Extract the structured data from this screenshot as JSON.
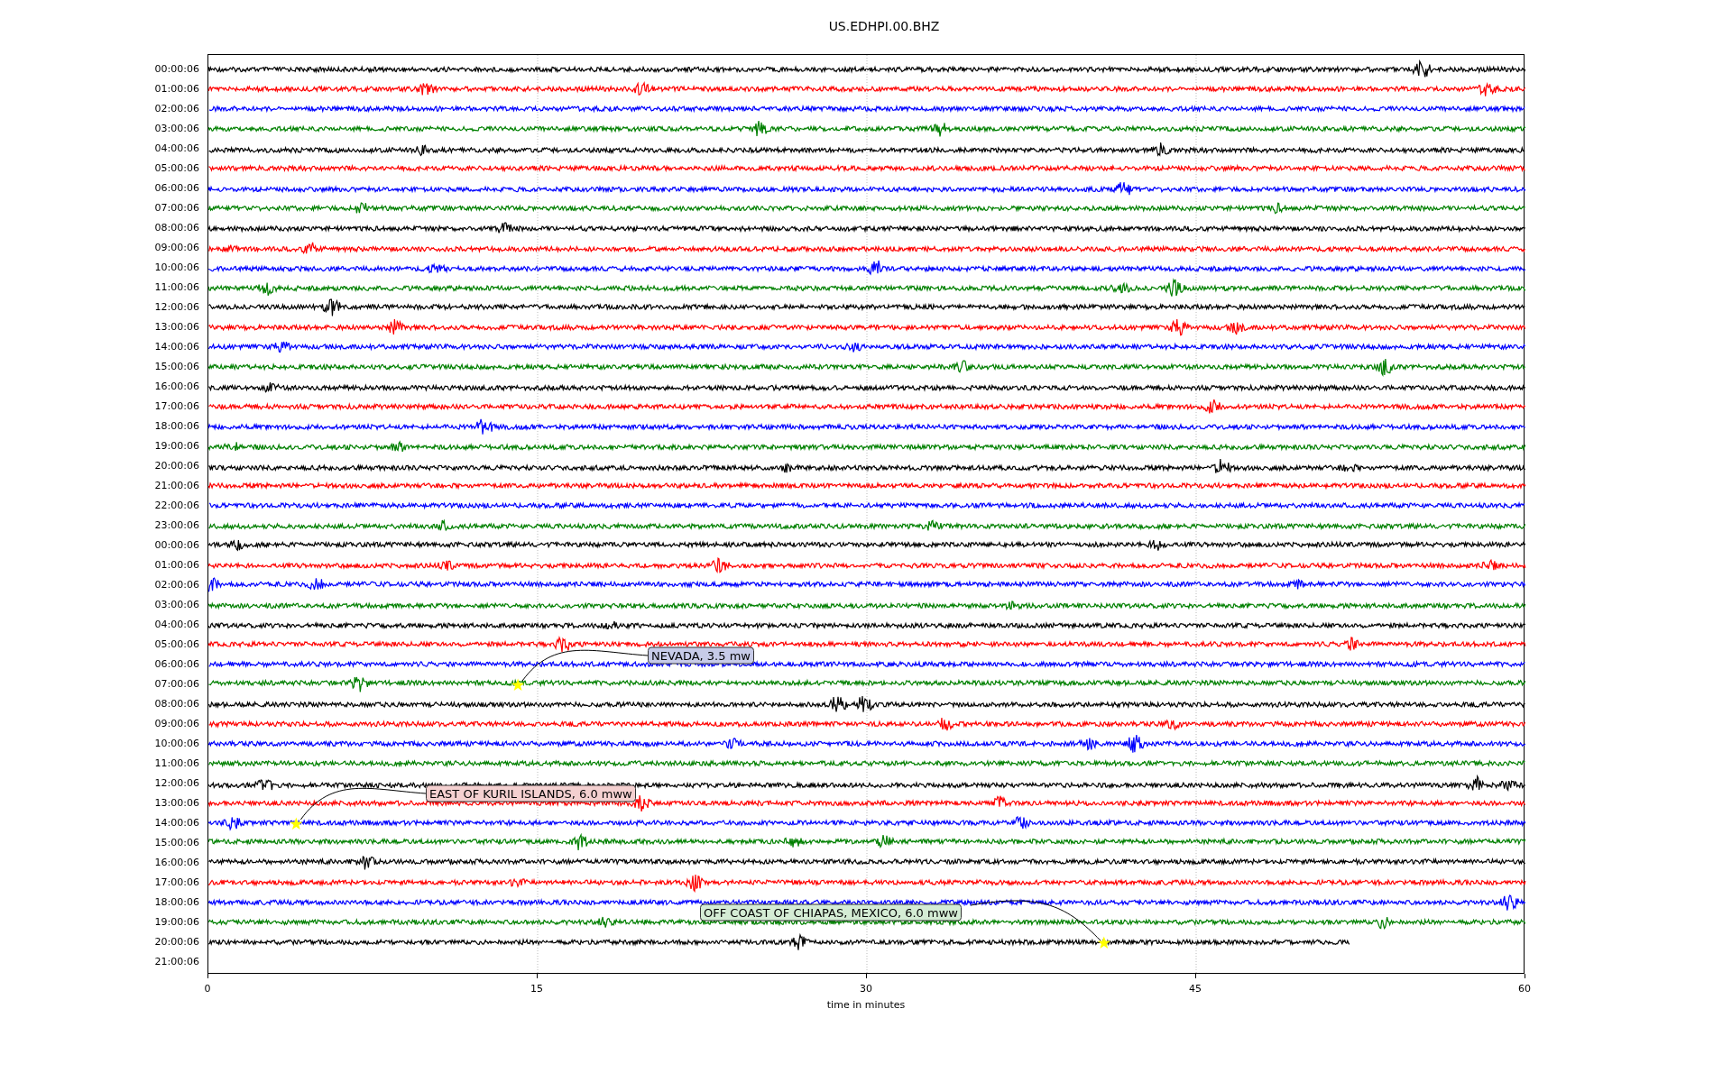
{
  "title": "US.EDHPI.00.BHZ",
  "xlabel": "time in minutes",
  "xticks": [
    "0",
    "15",
    "30",
    "45",
    "60"
  ],
  "rows": [
    {
      "label": "00:00:06",
      "kind": "full",
      "color": "#000000"
    },
    {
      "label": "01:00:06",
      "kind": "full",
      "color": "#ff0000"
    },
    {
      "label": "02:00:06",
      "kind": "full",
      "color": "#0000ff"
    },
    {
      "label": "03:00:06",
      "kind": "full",
      "color": "#008000"
    },
    {
      "label": "04:00:06",
      "kind": "full",
      "color": "#000000"
    },
    {
      "label": "05:00:06",
      "kind": "full",
      "color": "#ff0000"
    },
    {
      "label": "06:00:06",
      "kind": "full",
      "color": "#0000ff"
    },
    {
      "label": "07:00:06",
      "kind": "full",
      "color": "#008000"
    },
    {
      "label": "08:00:06",
      "kind": "full",
      "color": "#000000"
    },
    {
      "label": "09:00:06",
      "kind": "full",
      "color": "#ff0000"
    },
    {
      "label": "10:00:06",
      "kind": "full",
      "color": "#0000ff"
    },
    {
      "label": "11:00:06",
      "kind": "full",
      "color": "#008000"
    },
    {
      "label": "12:00:06",
      "kind": "full",
      "color": "#000000"
    },
    {
      "label": "13:00:06",
      "kind": "full",
      "color": "#ff0000"
    },
    {
      "label": "14:00:06",
      "kind": "full",
      "color": "#0000ff"
    },
    {
      "label": "15:00:06",
      "kind": "full",
      "color": "#008000"
    },
    {
      "label": "16:00:06",
      "kind": "full",
      "color": "#000000"
    },
    {
      "label": "17:00:06",
      "kind": "full",
      "color": "#ff0000"
    },
    {
      "label": "18:00:06",
      "kind": "full",
      "color": "#0000ff"
    },
    {
      "label": "19:00:06",
      "kind": "full",
      "color": "#008000"
    },
    {
      "label": "20:00:06",
      "kind": "full",
      "color": "#000000"
    },
    {
      "label": "21:00:06",
      "kind": "full",
      "color": "#ff0000"
    },
    {
      "label": "22:00:06",
      "kind": "full",
      "color": "#0000ff"
    },
    {
      "label": "23:00:06",
      "kind": "full",
      "color": "#008000"
    },
    {
      "label": "00:00:06",
      "kind": "full",
      "color": "#000000"
    },
    {
      "label": "01:00:06",
      "kind": "full",
      "color": "#ff0000"
    },
    {
      "label": "02:00:06",
      "kind": "full",
      "color": "#0000ff"
    },
    {
      "label": "03:00:06",
      "kind": "full",
      "color": "#008000"
    },
    {
      "label": "04:00:06",
      "kind": "full",
      "color": "#000000"
    },
    {
      "label": "05:00:06",
      "kind": "full",
      "color": "#ff0000"
    },
    {
      "label": "06:00:06",
      "kind": "full",
      "color": "#0000ff"
    },
    {
      "label": "07:00:06",
      "kind": "full",
      "color": "#008000",
      "event": {
        "label": "NEVADA, 3.5 mw"
      }
    },
    {
      "label": "08:00:06",
      "kind": "full",
      "color": "#000000"
    },
    {
      "label": "09:00:06",
      "kind": "full",
      "color": "#ff0000"
    },
    {
      "label": "10:00:06",
      "kind": "full",
      "color": "#0000ff"
    },
    {
      "label": "11:00:06",
      "kind": "full",
      "color": "#008000"
    },
    {
      "label": "12:00:06",
      "kind": "full",
      "color": "#000000"
    },
    {
      "label": "13:00:06",
      "kind": "full",
      "color": "#ff0000"
    },
    {
      "label": "14:00:06",
      "kind": "full",
      "color": "#0000ff",
      "event": {
        "label": "EAST OF KURIL ISLANDS, 6.0 mww"
      }
    },
    {
      "label": "15:00:06",
      "kind": "full",
      "color": "#008000"
    },
    {
      "label": "16:00:06",
      "kind": "full",
      "color": "#000000"
    },
    {
      "label": "17:00:06",
      "kind": "full",
      "color": "#ff0000"
    },
    {
      "label": "18:00:06",
      "kind": "full",
      "color": "#0000ff"
    },
    {
      "label": "19:00:06",
      "kind": "full",
      "color": "#008000"
    },
    {
      "label": "20:00:06",
      "kind": "partial",
      "color": "#000000",
      "event": {
        "label": "OFF COAST OF CHIAPAS, MEXICO, 6.0 mww"
      }
    },
    {
      "label": "21:00:06",
      "kind": "none"
    }
  ]
}
